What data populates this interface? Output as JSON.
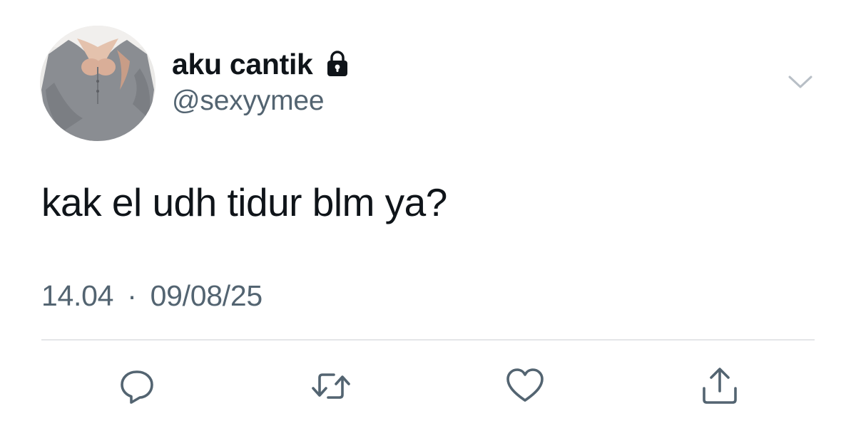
{
  "tweet": {
    "display_name": "aku cantik",
    "handle": "@sexyymee",
    "protected_icon": "lock-icon",
    "text": "kak el udh tidur blm ya?",
    "time": "14.04",
    "separator": "·",
    "date": "09/08/25"
  },
  "actions": {
    "reply_icon": "reply-icon",
    "retweet_icon": "retweet-icon",
    "like_icon": "heart-icon",
    "share_icon": "share-icon"
  },
  "more_icon": "chevron-down-icon",
  "colors": {
    "primary_text": "#0f1419",
    "secondary_text": "#536471",
    "divider": "#e4e6e8",
    "icon": "#536471"
  }
}
